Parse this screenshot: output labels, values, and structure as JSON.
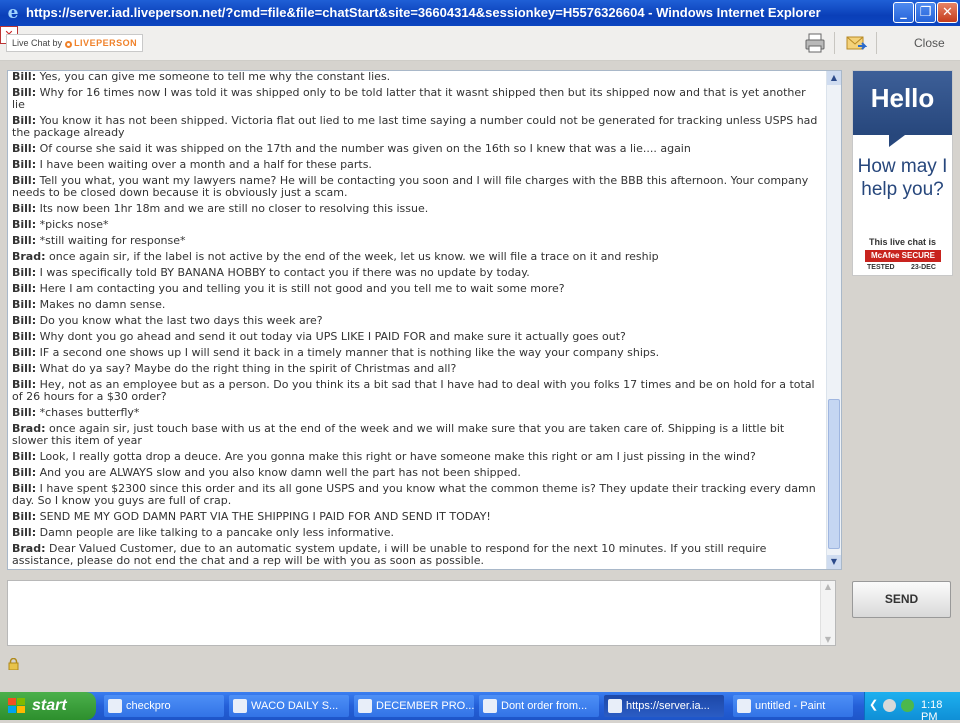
{
  "window": {
    "title": "https://server.iad.liveperson.net/?cmd=file&file=chatStart&site=36604314&sessionkey=H5576326604 - Windows Internet Explorer",
    "minimize": "_",
    "maximize": "❐",
    "close": "✕"
  },
  "toolbar": {
    "logo_prefix": "Live Chat by",
    "logo_brand": "LIVEPERSON",
    "close_label": "Close"
  },
  "transcript": [
    {
      "speaker": "Bill:",
      "text": "Yes, you can give me someone to tell me why the constant lies."
    },
    {
      "speaker": "Bill:",
      "text": "Why for 16 times now I was told it was shipped only to be told latter that it wasnt shipped then but its shipped now and that is yet another lie"
    },
    {
      "speaker": "Bill:",
      "text": "You know it has not been shipped. Victoria flat out lied to me last time saying a number could not be generated for tracking unless USPS had the package already"
    },
    {
      "speaker": "Bill:",
      "text": "Of course she said it was shipped on the 17th and the number was given on the 16th so I knew that was a lie.... again"
    },
    {
      "speaker": "Bill:",
      "text": "I have been waiting over a month and a half for these parts."
    },
    {
      "speaker": "Bill:",
      "text": "Tell you what, you want my lawyers name? He will be contacting you soon and I will file charges with the BBB this afternoon. Your company needs to be closed down because it is obviously just a scam."
    },
    {
      "speaker": "Bill:",
      "text": "Its now been 1hr 18m and we are still no closer to resolving this issue."
    },
    {
      "speaker": "Bill:",
      "text": "*picks nose*"
    },
    {
      "speaker": "Bill:",
      "text": "*still waiting for response*"
    },
    {
      "speaker": "Brad:",
      "text": "once again sir, if the label is not active by the end of the week, let us know. we will file a trace on it and reship"
    },
    {
      "speaker": "Bill:",
      "text": "I was specifically told BY BANANA HOBBY to contact you if there was no update by today."
    },
    {
      "speaker": "Bill:",
      "text": "Here I am contacting you and telling you it is still not good and you tell me to wait some more?"
    },
    {
      "speaker": "Bill:",
      "text": "Makes no damn sense."
    },
    {
      "speaker": "Bill:",
      "text": "Do you know what the last two days this week are?"
    },
    {
      "speaker": "Bill:",
      "text": "Why dont you go ahead and send it out today via UPS LIKE I PAID FOR and make sure it actually goes out?"
    },
    {
      "speaker": "Bill:",
      "text": "IF a second one shows up I will send it back in a timely manner that is nothing like the way your company ships."
    },
    {
      "speaker": "Bill:",
      "text": "What do ya say? Maybe do the right thing in the spirit of Christmas and all?"
    },
    {
      "speaker": "Bill:",
      "text": "Hey, not as an employee but as a person. Do you think its a bit sad that I have had to deal with you folks 17 times and be on hold for a total of 26 hours for a $30 order?"
    },
    {
      "speaker": "Bill:",
      "text": "*chases butterfly*"
    },
    {
      "speaker": "Brad:",
      "text": "once again sir, just touch base with us at the end of the week and we will make sure that you are taken care of. Shipping is a little bit slower this item of year"
    },
    {
      "speaker": "Bill:",
      "text": "Look, I really gotta drop a deuce. Are you gonna make this right or have someone make this right or am I just pissing in the wind?"
    },
    {
      "speaker": "Bill:",
      "text": "And you are ALWAYS slow and you also know damn well the part has not been shipped."
    },
    {
      "speaker": "Bill:",
      "text": "I have spent $2300 since this order and its all gone USPS and you know what the common theme is? They update their tracking every damn day. So I know you guys are full of crap."
    },
    {
      "speaker": "Bill:",
      "text": "SEND ME MY GOD DAMN PART VIA THE SHIPPING I PAID FOR AND SEND IT TODAY!"
    },
    {
      "speaker": "Bill:",
      "text": "Damn people are like talking to a pancake only less informative."
    },
    {
      "speaker": "Brad:",
      "text": "Dear Valued Customer, due to an automatic system update, i will be unable to respond for the next 10 minutes. If you still require assistance, please do not end the chat and a rep will be with you as soon as possible."
    }
  ],
  "ad": {
    "hello": "Hello",
    "help": "How may I help you?",
    "live_chat": "This live chat is",
    "mcafee": "McAfee SECURE",
    "tested": "TESTED",
    "date": "23-DEC"
  },
  "input": {
    "value": ""
  },
  "send_label": "SEND",
  "taskbar": {
    "start": "start",
    "buttons": [
      {
        "label": "checkpro",
        "active": false
      },
      {
        "label": "WACO DAILY S...",
        "active": false
      },
      {
        "label": "DECEMBER PRO...",
        "active": false
      },
      {
        "label": "Dont order from...",
        "active": false
      },
      {
        "label": "https://server.ia...",
        "active": true
      },
      {
        "label": "untitled - Paint",
        "active": false
      }
    ],
    "tray_chevron": "❮",
    "time": "1:18 PM"
  }
}
